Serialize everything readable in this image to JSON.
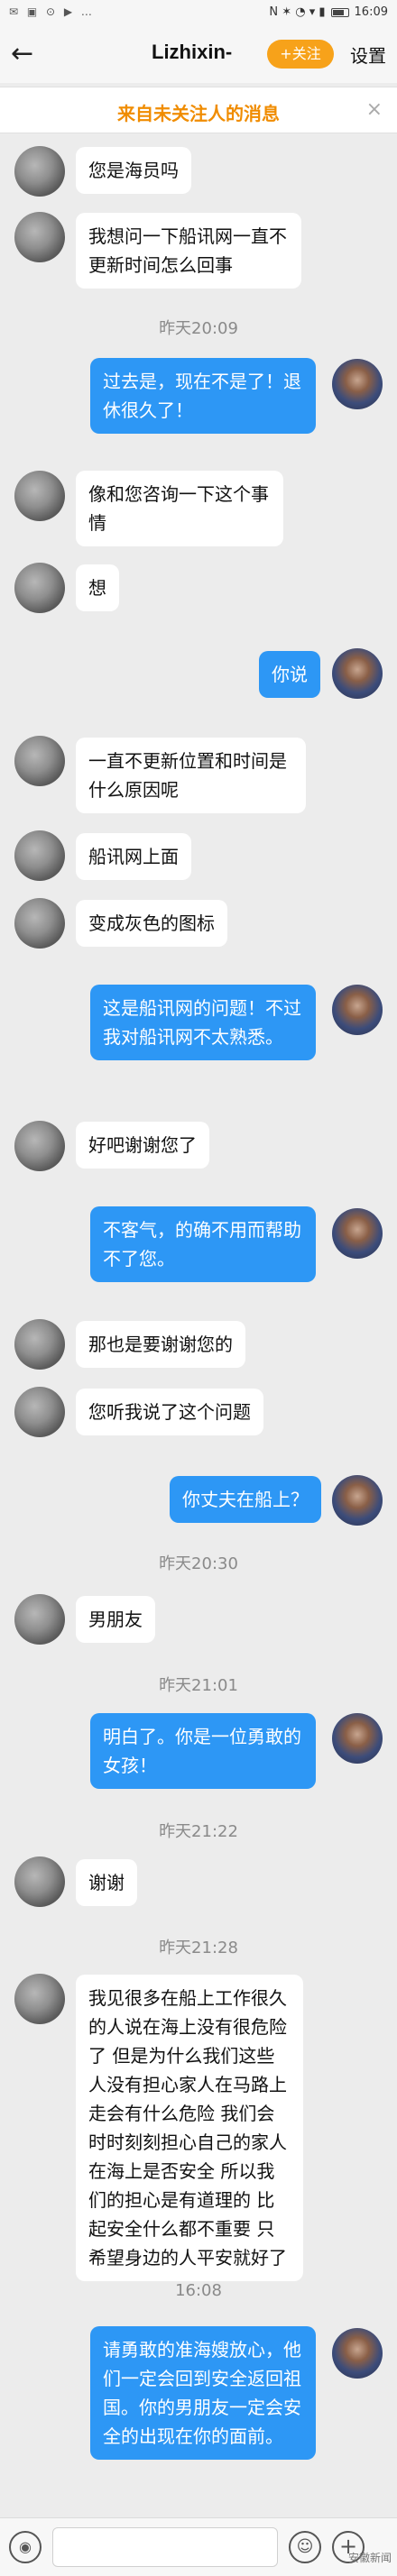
{
  "status_bar": {
    "left_icons": "✉ ▣ ⊙ ▶ …",
    "right_text": "N ✶ ◔ ▾ ▮",
    "time": "16:09"
  },
  "header": {
    "back_icon": "←",
    "title": "Lizhixin-",
    "follow_label": "+关注",
    "settings_label": "设置"
  },
  "banner": {
    "title": "来自未关注人的消息",
    "close_icon": "×"
  },
  "messages": [
    {
      "side": "them",
      "text": "您是海员吗"
    },
    {
      "side": "them",
      "text": "我想问一下船讯网一直不更新时间怎么回事"
    },
    {
      "type": "time",
      "text": "昨天20:09"
    },
    {
      "side": "me",
      "text": "过去是，现在不是了！退休很久了！"
    },
    {
      "side": "them",
      "text": "像和您咨询一下这个事情"
    },
    {
      "side": "them",
      "text": "想"
    },
    {
      "side": "me",
      "text": "你说"
    },
    {
      "side": "them",
      "text": "一直不更新位置和时间是什么原因呢"
    },
    {
      "side": "them",
      "text": "船讯网上面"
    },
    {
      "side": "them",
      "text": "变成灰色的图标"
    },
    {
      "side": "me",
      "text": "这是船讯网的问题！不过我对船讯网不太熟悉。"
    },
    {
      "side": "them",
      "text": "好吧谢谢您了"
    },
    {
      "side": "me",
      "text": "不客气，的确不用而帮助不了您。"
    },
    {
      "side": "them",
      "text": "那也是要谢谢您的"
    },
    {
      "side": "them",
      "text": "您听我说了这个问题"
    },
    {
      "side": "me",
      "text": "你丈夫在船上？"
    },
    {
      "type": "time",
      "text": "昨天20:30"
    },
    {
      "side": "them",
      "text": "男朋友"
    },
    {
      "type": "time",
      "text": "昨天21:01"
    },
    {
      "side": "me",
      "text": "明白了。你是一位勇敢的女孩！"
    },
    {
      "type": "time",
      "text": "昨天21:22"
    },
    {
      "side": "them",
      "text": "谢谢"
    },
    {
      "type": "time",
      "text": "昨天21:28"
    },
    {
      "side": "them",
      "text": "我见很多在船上工作很久的人说在海上没有很危险了 但是为什么我们这些人没有担心家人在马路上走会有什么危险 我们会时时刻刻担心自己的家人在海上是否安全  所以我们的担心是有道理的 比起安全什么都不重要 只希望身边的人平安就好了"
    },
    {
      "type": "time",
      "text": "16:08"
    },
    {
      "side": "me",
      "text": "请勇敢的准海嫂放心，他们一定会回到安全返回祖国。你的男朋友一定会安全的出现在你的面前。"
    }
  ],
  "input_bar": {
    "voice_icon": "◉",
    "emoji_icon": "☺",
    "plus_icon": "+",
    "placeholder": ""
  },
  "watermark": "安徽新闻"
}
